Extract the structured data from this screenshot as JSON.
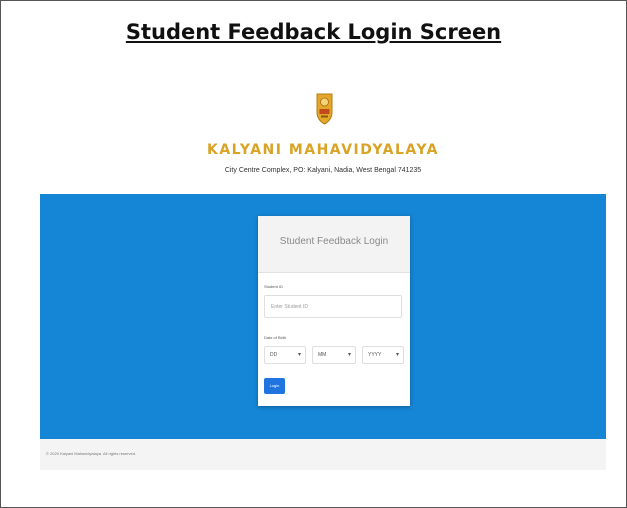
{
  "caption": "Student Feedback Login Screen",
  "header": {
    "logo_icon": "college-emblem-icon",
    "college_name": "KALYANI MAHAVIDYALAYA",
    "address": "City Centre Complex, PO: Kalyani, Nadia, West Bengal 741235"
  },
  "login": {
    "title": "Student Feedback Login",
    "student_id_label": "Student ID",
    "student_id_placeholder": "Enter Student ID",
    "dob_label": "Date of Birth",
    "dob_day": "DD",
    "dob_month": "MM",
    "dob_year": "YYYY",
    "login_label": "Login"
  },
  "footer": {
    "text": "© 2020 Kalyani Mahavidyalaya. All rights reserved."
  },
  "colors": {
    "accent_blue": "#1585d6",
    "button_blue": "#1f74e0",
    "brand_gold": "#d9a324"
  }
}
